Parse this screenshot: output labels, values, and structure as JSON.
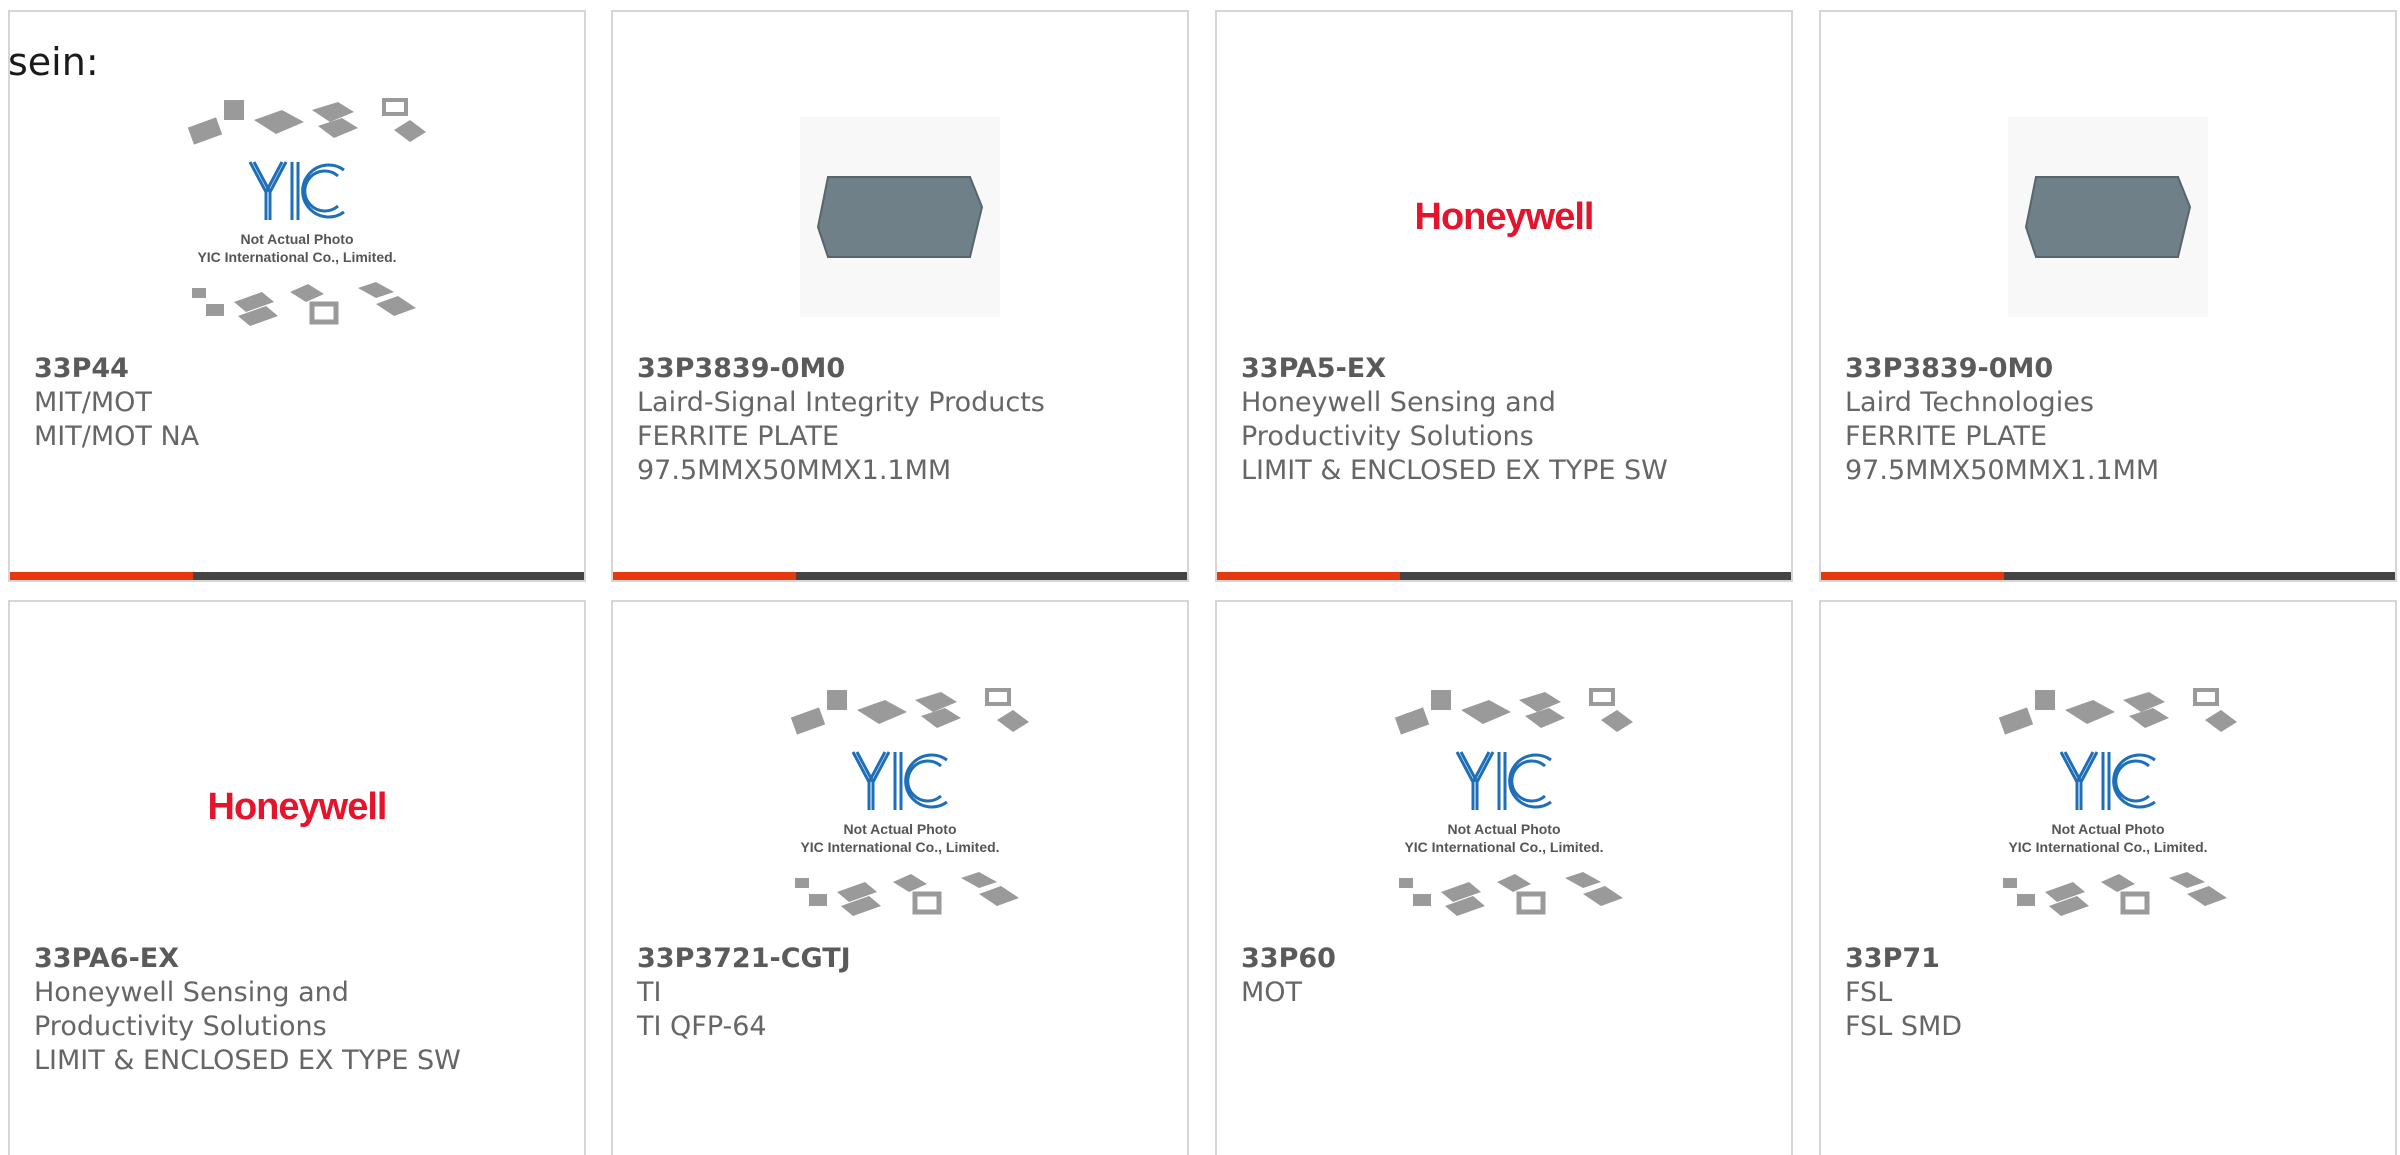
{
  "heading_fragment": "sein:",
  "colors": {
    "accent": "#e5380e",
    "bar": "#444444",
    "honeywell_red": "#e4142c"
  },
  "placeholder_caption": {
    "line1": "Not Actual Photo",
    "line2": "YIC International Co., Limited."
  },
  "products": [
    {
      "part": "33P44",
      "lines": [
        "MIT/MOT",
        "MIT/MOT NA"
      ],
      "image": "yic-placeholder-icon"
    },
    {
      "part": "33P3839-0M0",
      "lines": [
        "Laird-Signal Integrity Products",
        "FERRITE PLATE",
        "97.5MMX50MMX1.1MM"
      ],
      "image": "ferrite-plate-icon"
    },
    {
      "part": "33PA5-EX",
      "lines": [
        "Honeywell Sensing and",
        "Productivity Solutions",
        "LIMIT & ENCLOSED EX TYPE SW"
      ],
      "image": "honeywell-logo",
      "logo_text": "Honeywell"
    },
    {
      "part": "33P3839-0M0",
      "lines": [
        "Laird Technologies",
        "FERRITE PLATE",
        "97.5MMX50MMX1.1MM"
      ],
      "image": "ferrite-plate-icon"
    },
    {
      "part": "33PA6-EX",
      "lines": [
        "Honeywell Sensing and",
        "Productivity Solutions",
        "LIMIT & ENCLOSED EX TYPE SW"
      ],
      "image": "honeywell-logo",
      "logo_text": "Honeywell"
    },
    {
      "part": "33P3721-CGTJ",
      "lines": [
        "TI",
        "TI QFP-64"
      ],
      "image": "yic-placeholder-icon"
    },
    {
      "part": "33P60",
      "lines": [
        "MOT"
      ],
      "image": "yic-placeholder-icon"
    },
    {
      "part": "33P71",
      "lines": [
        "FSL",
        "FSL SMD"
      ],
      "image": "yic-placeholder-icon"
    }
  ]
}
